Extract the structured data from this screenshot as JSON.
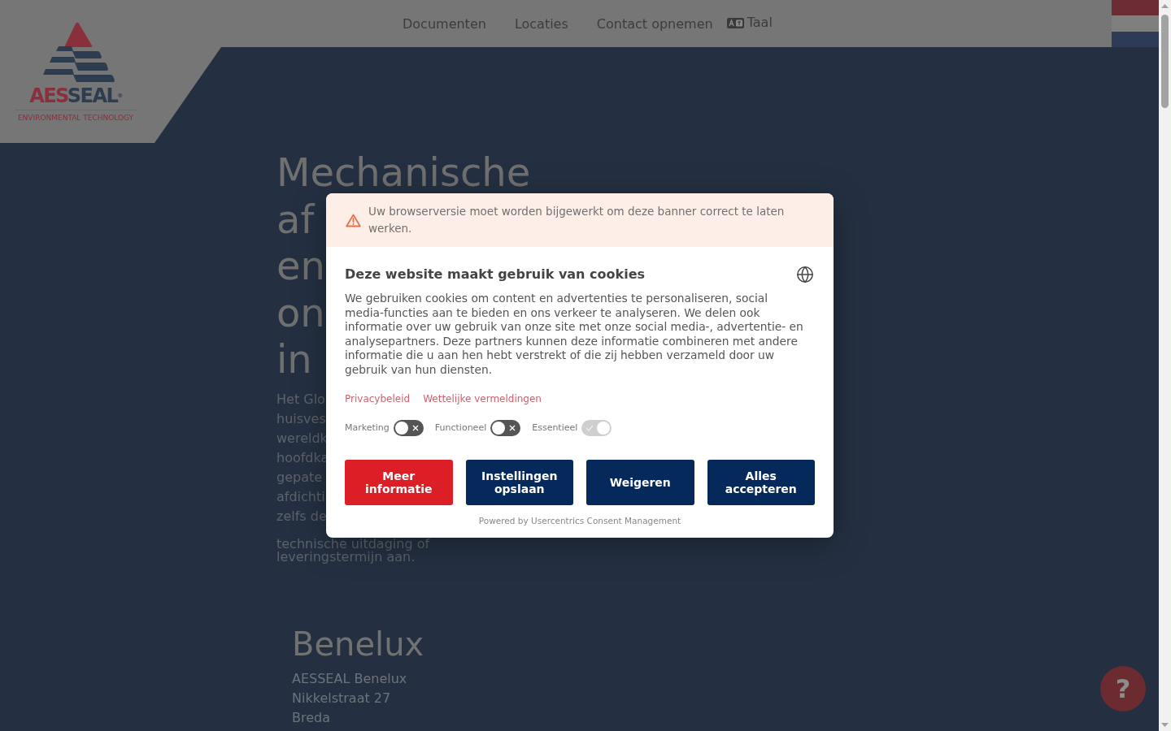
{
  "header": {
    "logo": {
      "wordmark_part_1": "AES",
      "wordmark_part_2": "SEAL",
      "registered": "®",
      "tagline": "ENVIRONMENTAL TECHNOLOGY"
    },
    "nav": [
      "Documenten",
      "Locaties",
      "Contact opnemen"
    ],
    "language": {
      "label": "Taal"
    }
  },
  "page": {
    "heading_lines": [
      "Mechanische",
      "af",
      "en",
      "on",
      "in"
    ],
    "intro_lines": [
      "Het Glo",
      "huisves",
      "wereldk",
      "hoofdka",
      "gepate",
      "afdichti",
      "zelfs de",
      "technische uitdaging of",
      "leveringstermijn aan."
    ],
    "office": {
      "title": "Benelux",
      "lines": [
        "AESSEAL Benelux",
        "Nikkelstraat 27",
        "Breda"
      ]
    }
  },
  "help_button": {
    "label": "?"
  },
  "cookie_dialog": {
    "warning": "Uw browserversie moet worden bijgewerkt om deze banner correct te laten werken.",
    "title": "Deze website maakt gebruik van cookies",
    "text": "We gebruiken cookies om content en advertenties te personaliseren, social media-functies aan te bieden en ons verkeer te analyseren. We delen ook informatie over uw gebruik van onze site met onze social media-, advertentie- en analysepartners. Deze partners kunnen deze informatie combineren met andere informatie die u aan hen hebt verstrekt of die zij hebben verzameld door uw gebruik van hun diensten.",
    "links": [
      "Privacybeleid",
      "Wettelijke vermeldingen"
    ],
    "toggles": [
      {
        "label": "Marketing",
        "checked": false,
        "disabled": false
      },
      {
        "label": "Functioneel",
        "checked": false,
        "disabled": false
      },
      {
        "label": "Essentieel",
        "checked": true,
        "disabled": true
      }
    ],
    "buttons": [
      {
        "label": "Meer informatie",
        "color": "#dc1f26"
      },
      {
        "label": "Instellingen opslaan",
        "color": "#05295b"
      },
      {
        "label": "Weigeren",
        "color": "#05295b"
      },
      {
        "label": "Alles accepteren",
        "color": "#05295b"
      }
    ],
    "footer": "Powered by Usercentrics Consent Management"
  }
}
